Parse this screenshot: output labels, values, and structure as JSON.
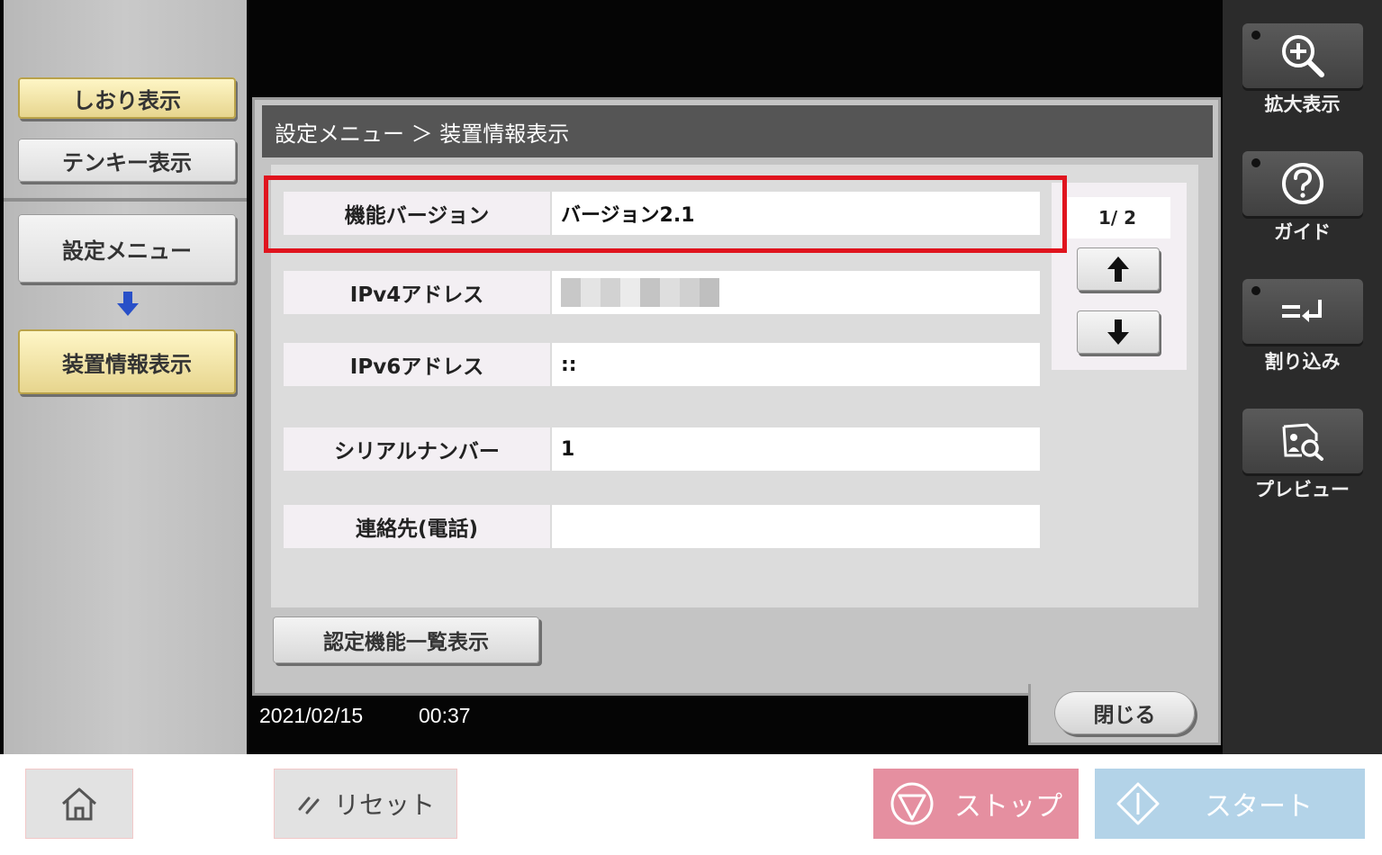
{
  "left_panel": {
    "bookmark_label": "しおり表示",
    "tenkey_label": "テンキー表示",
    "settings_menu_label": "設定メニュー",
    "device_info_label": "装置情報表示"
  },
  "dialog": {
    "breadcrumb": "設定メニュー ＞ 装置情報表示",
    "rows": [
      {
        "label": "機能バージョン",
        "value": "バージョン2.1"
      },
      {
        "label": "IPv4アドレス",
        "value": ""
      },
      {
        "label": "IPv6アドレス",
        "value": "::"
      },
      {
        "label": "シリアルナンバー",
        "value": "1"
      },
      {
        "label": "連絡先(電話)",
        "value": ""
      }
    ],
    "page_indicator": "1/ 2",
    "cert_button": "認定機能一覧表示",
    "close_button": "閉じる"
  },
  "status": {
    "date": "2021/02/15",
    "time": "00:37"
  },
  "right_panel": {
    "zoom_label": "拡大表示",
    "guide_label": "ガイド",
    "interrupt_label": "割り込み",
    "preview_label": "プレビュー"
  },
  "bottom_bar": {
    "reset_label": "リセット",
    "stop_label": "ストップ",
    "start_label": "スタート"
  },
  "colors": {
    "highlight": "#e0141e",
    "stop": "#e58fa0",
    "start": "#b3d3e8"
  },
  "icons": [
    "zoom-in-icon",
    "help-icon",
    "interrupt-icon",
    "preview-icon",
    "home-icon",
    "reset-icon",
    "stop-icon",
    "start-icon",
    "arrow-up-icon",
    "arrow-down-icon"
  ]
}
